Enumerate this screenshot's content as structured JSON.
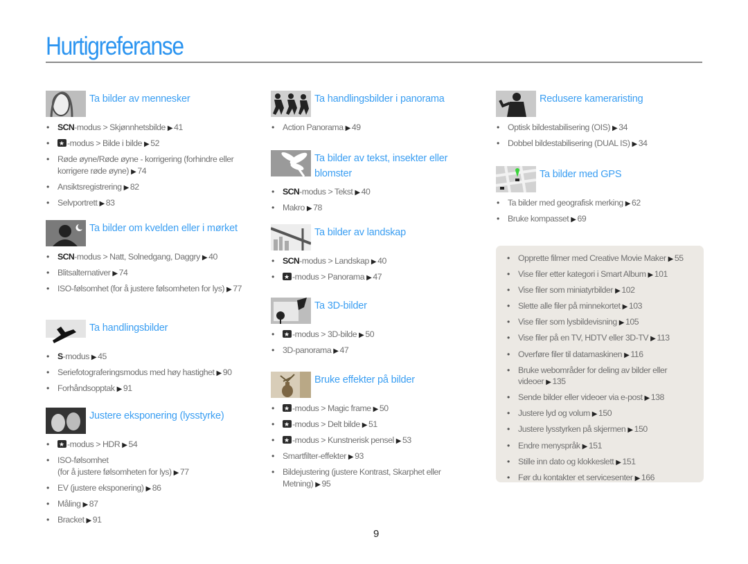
{
  "page": {
    "title": "Hurtigreferanse",
    "page_number": "9",
    "arrow_glyph": "▶"
  },
  "sections": [
    {
      "id": "people",
      "icon": "portrait-photo-icon",
      "title": "Ta bilder av mennesker",
      "items": [
        {
          "prefix": "SCN",
          "text": "-modus > Skjønnhetsbilde",
          "page": "41"
        },
        {
          "prefix_icon": "camera-mode-icon",
          "text": "-modus > Bilde i bilde",
          "page": "52"
        },
        {
          "text": "Røde øyne/Røde øyne - korrigering (forhindre eller korrigere røde øyne)",
          "page": "74"
        },
        {
          "text": "Ansiktsregistrering",
          "page": "82"
        },
        {
          "text": "Selvportrett",
          "page": "83"
        }
      ]
    },
    {
      "id": "night",
      "icon": "night-photo-icon",
      "title": "Ta bilder om kvelden eller i mørket",
      "items": [
        {
          "prefix": "SCN",
          "text": "-modus > Natt, Solnedgang, Daggry",
          "page": "40"
        },
        {
          "text": "Blitsalternativer",
          "page": "74"
        },
        {
          "text": "ISO-følsomhet (for å justere følsomheten for lys)",
          "page": "77"
        }
      ]
    },
    {
      "id": "action",
      "icon": "snowboarder-icon",
      "title": "Ta handlingsbilder",
      "items": [
        {
          "prefix": "S",
          "text": "-modus",
          "page": "45"
        },
        {
          "text": "Seriefotograferingsmodus med høy hastighet",
          "page": "90"
        },
        {
          "text": "Forhåndsopptak",
          "page": "91"
        }
      ]
    },
    {
      "id": "exposure",
      "icon": "couple-photo-icon",
      "title": "Justere eksponering (lysstyrke)",
      "items": [
        {
          "prefix_icon": "camera-mode-icon",
          "text": "-modus > HDR",
          "page": "54"
        },
        {
          "text": "ISO-følsomhet\n(for å justere følsomheten for lys)",
          "page": "77"
        },
        {
          "text": "EV (justere eksponering)",
          "page": "86"
        },
        {
          "text": "Måling",
          "page": "87"
        },
        {
          "text": "Bracket",
          "page": "91"
        }
      ]
    },
    {
      "id": "action-panorama",
      "icon": "football-players-icon",
      "title": "Ta handlingsbilder i panorama",
      "items": [
        {
          "text": "Action Panorama",
          "page": "49"
        }
      ]
    },
    {
      "id": "macro",
      "icon": "flower-icon",
      "title": "Ta bilder av tekst, insekter eller blomster",
      "items": [
        {
          "prefix": "SCN",
          "text": "-modus > Tekst",
          "page": "40"
        },
        {
          "text": "Makro",
          "page": "78"
        }
      ]
    },
    {
      "id": "landscape",
      "icon": "bridge-landscape-icon",
      "title": "Ta bilder av landskap",
      "items": [
        {
          "prefix": "SCN",
          "text": "-modus > Landskap",
          "page": "40"
        },
        {
          "prefix_icon": "camera-mode-icon",
          "text": "-modus > Panorama",
          "page": "47"
        }
      ]
    },
    {
      "id": "3d",
      "icon": "butterfly-3d-icon",
      "title": "Ta 3D-bilder",
      "items": [
        {
          "prefix_icon": "camera-mode-icon",
          "text": "-modus > 3D-bilde",
          "page": "50"
        },
        {
          "text": "3D-panorama",
          "page": "47"
        }
      ]
    },
    {
      "id": "effects",
      "icon": "vase-photo-icon",
      "title": "Bruke effekter på bilder",
      "items": [
        {
          "prefix_icon": "camera-mode-icon",
          "text": "-modus > Magic frame",
          "page": "50"
        },
        {
          "prefix_icon": "camera-mode-icon",
          "text": "-modus > Delt bilde",
          "page": "51"
        },
        {
          "prefix_icon": "camera-mode-icon",
          "text": "-modus > Kunstnerisk pensel",
          "page": "53"
        },
        {
          "text": "Smartfilter-effekter",
          "page": "93"
        },
        {
          "text": "Bildejustering (justere Kontrast, Skarphet eller Metning)",
          "page": "95"
        }
      ]
    },
    {
      "id": "shake",
      "icon": "waving-person-icon",
      "title": "Redusere kameraristing",
      "items": [
        {
          "text": "Optisk bildestabilisering (OIS)",
          "page": "34"
        },
        {
          "text": "Dobbel bildestabilisering (DUAL IS)",
          "page": "34"
        }
      ]
    },
    {
      "id": "gps",
      "icon": "gps-map-icon",
      "title": "Ta bilder med GPS",
      "items": [
        {
          "text": "Ta bilder med geografisk merking",
          "page": "62"
        },
        {
          "text": "Bruke kompasset",
          "page": "69"
        }
      ]
    }
  ],
  "box": {
    "items": [
      {
        "text": "Opprette filmer med Creative Movie Maker",
        "page": "55"
      },
      {
        "text": "Vise filer etter kategori i Smart Album",
        "page": "101"
      },
      {
        "text": "Vise filer som miniatyrbilder",
        "page": "102"
      },
      {
        "text": "Slette alle filer på minnekortet",
        "page": "103"
      },
      {
        "text": "Vise filer som lysbildevisning",
        "page": "105"
      },
      {
        "text": "Vise filer på en TV, HDTV eller 3D-TV",
        "page": "113"
      },
      {
        "text": "Overføre filer til datamaskinen",
        "page": "116"
      },
      {
        "text": "Bruke webområder for deling av bilder eller videoer",
        "page": "135"
      },
      {
        "text": "Sende bilder eller videoer via e-post",
        "page": "138"
      },
      {
        "text": "Justere lyd og volum",
        "page": "150"
      },
      {
        "text": "Justere lysstyrken på skjermen",
        "page": "150"
      },
      {
        "text": "Endre menyspråk",
        "page": "151"
      },
      {
        "text": "Stille inn dato og klokkeslett",
        "page": "151"
      },
      {
        "text": "Før du kontakter et servicesenter",
        "page": "166"
      }
    ]
  },
  "colors": {
    "title": "#2b94f0",
    "section_title": "#3a9ef2",
    "body_text": "#707070",
    "rule": "#8a8a8a",
    "box_bg": "#ece9e4"
  }
}
